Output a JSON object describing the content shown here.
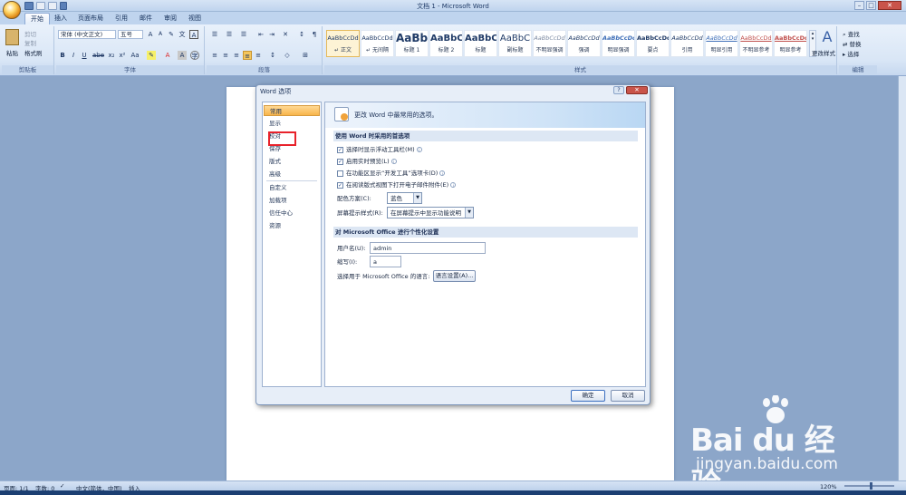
{
  "window": {
    "title": "文档 1 - Microsoft Word"
  },
  "tabs": [
    "开始",
    "插入",
    "页面布局",
    "引用",
    "邮件",
    "审阅",
    "视图"
  ],
  "ribbon": {
    "clipboard": {
      "paste": "粘贴",
      "cut": "剪切",
      "copy": "复制",
      "format_painter": "格式刷",
      "label": "剪贴板"
    },
    "font": {
      "family": "宋体 (中文正文)",
      "size": "五号",
      "label": "字体"
    },
    "paragraph": {
      "label": "段落"
    },
    "styles": {
      "label": "样式",
      "items": [
        {
          "preview": "AaBbCcDd",
          "name": "↵ 正文"
        },
        {
          "preview": "AaBbCcDd",
          "name": "↵ 无间隔"
        },
        {
          "preview": "AaBb",
          "name": "标题 1"
        },
        {
          "preview": "AaBbC",
          "name": "标题 2"
        },
        {
          "preview": "AaBbC",
          "name": "标题"
        },
        {
          "preview": "AaBbC",
          "name": "副标题"
        },
        {
          "preview": "AaBbCcDd",
          "name": "不明显强调"
        },
        {
          "preview": "AaBbCcDd",
          "name": "强调"
        },
        {
          "preview": "AaBbCcDd",
          "name": "明显强调"
        },
        {
          "preview": "AaBbCcDd",
          "name": "要点"
        },
        {
          "preview": "AaBbCcDd",
          "name": "引用"
        },
        {
          "preview": "AaBbCcDd",
          "name": "明显引用"
        },
        {
          "preview": "AaBbCcDd",
          "name": "不明显参考"
        },
        {
          "preview": "AaBbCcDd",
          "name": "明显参考"
        }
      ],
      "change_styles": "更改样式"
    },
    "editing": {
      "find": "查找",
      "replace": "替换",
      "select": "选择",
      "label": "编辑"
    }
  },
  "dialog": {
    "title": "Word 选项",
    "nav": [
      "常用",
      "显示",
      "校对",
      "保存",
      "版式",
      "高级",
      "自定义",
      "加载项",
      "信任中心",
      "资源"
    ],
    "banner": "更改 Word 中最常用的选项。",
    "section1": "使用 Word 时采用的首选项",
    "options": [
      "选择时显示浮动工具栏(M)",
      "启用实时预览(L)",
      "在功能区显示“开发工具”选项卡(D)",
      "在阅读版式视图下打开电子邮件附件(E)"
    ],
    "color_scheme_label": "配色方案(C):",
    "color_scheme_value": "蓝色",
    "screentip_label": "屏幕提示样式(R):",
    "screentip_value": "在屏幕提示中显示功能说明",
    "section2": "对 Microsoft Office 进行个性化设置",
    "username_label": "用户名(U):",
    "username_value": "admin",
    "initials_label": "缩写(I):",
    "initials_value": "a",
    "lang_label": "选择用于 Microsoft Office 的语言:",
    "lang_button": "语言设置(A)...",
    "ok": "确定",
    "cancel": "取消"
  },
  "status": {
    "page": "页面: 1/1",
    "words": "字数: 0",
    "lang": "中文(简体，中国)",
    "mode": "插入",
    "zoom": "120%"
  },
  "watermark": {
    "brand": "Bai du 经验",
    "url": "jingyan.baidu.com"
  }
}
